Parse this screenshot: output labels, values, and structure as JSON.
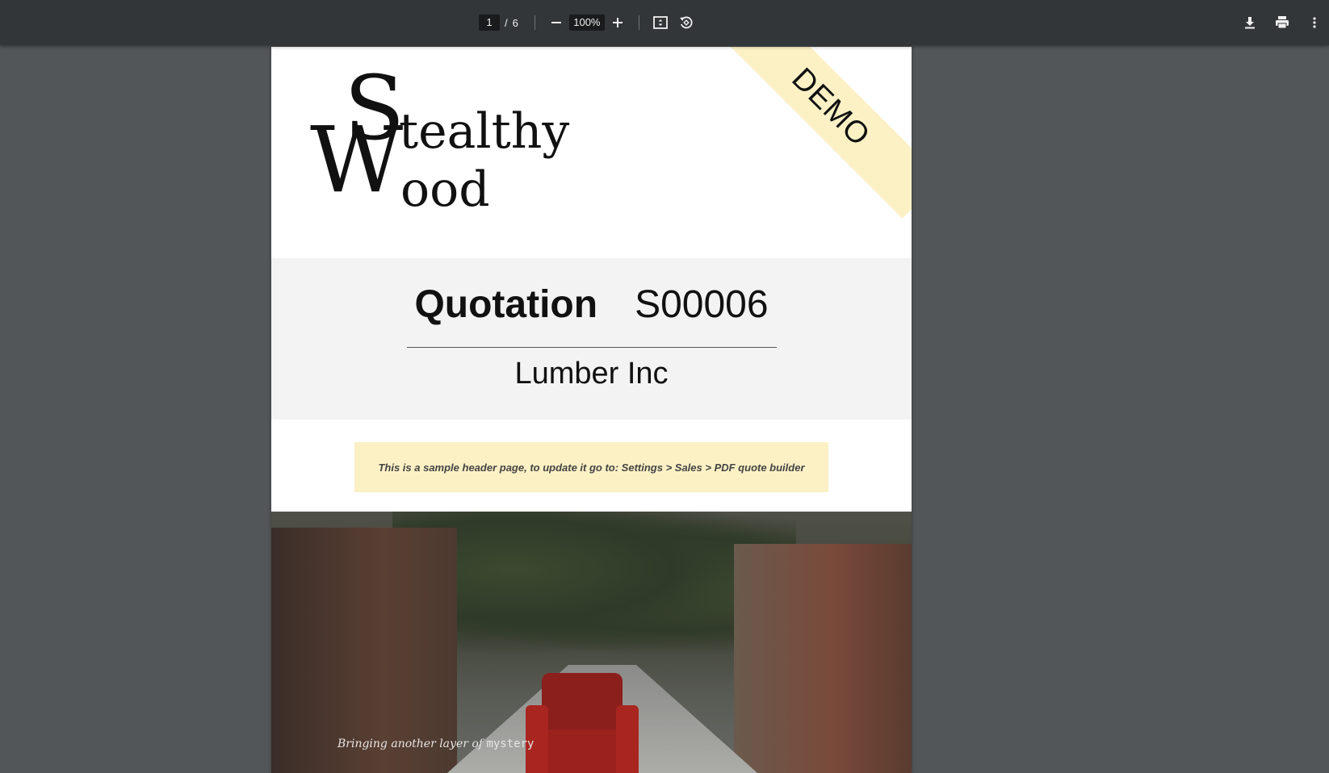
{
  "toolbar": {
    "page_current": "1",
    "page_sep": "/",
    "page_total": "6",
    "zoom": "100%",
    "icons": [
      "minus-icon",
      "plus-icon",
      "fit-page-icon",
      "rotate-icon",
      "download-icon",
      "print-icon",
      "more-vert-icon"
    ]
  },
  "document": {
    "logo": {
      "letter_s": "S",
      "rest_top": "tealthy",
      "letter_w": "W",
      "rest_bottom": "ood"
    },
    "ribbon": "DEMO",
    "title_label": "Quotation",
    "title_number": "S00006",
    "customer": "Lumber Inc",
    "note": "This is a sample header page, to update it go to: Settings > Sales > PDF quote builder",
    "tagline_prefix": "Bringing another layer of",
    "tagline_suffix": "mystery"
  },
  "colors": {
    "toolbar_bg": "#323639",
    "viewer_bg": "#525659",
    "band_bg": "#f3f3f3",
    "note_bg": "#fbf1c5"
  }
}
